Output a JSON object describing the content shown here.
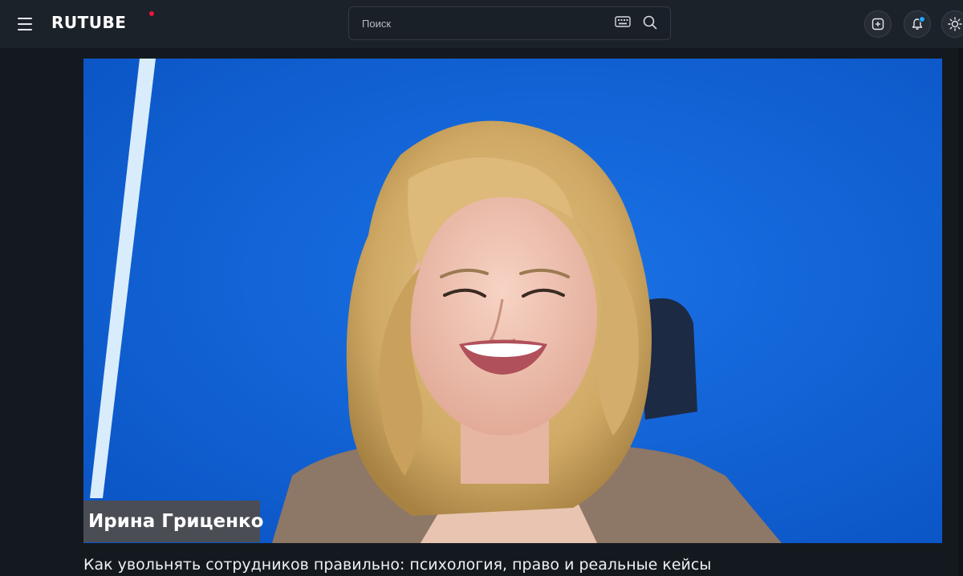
{
  "header": {
    "logo_text": "RUTUBE",
    "search": {
      "placeholder": "Поиск",
      "value": ""
    },
    "icons": {
      "menu": "hamburger-menu-icon",
      "keyboard": "keyboard-icon",
      "search": "search-icon",
      "upload": "add-video-icon",
      "notifications": "bell-icon",
      "theme": "sun-icon"
    },
    "notification_badge_color": "#22a7ff",
    "logo_accent_color": "#ed143b"
  },
  "video": {
    "lower_third_name": "Ирина Гриценко",
    "title": "Как увольнять сотрудников правильно: психология, право и реальные кейсы"
  },
  "colors": {
    "background": "#14191f",
    "header": "#1c2229",
    "video_backdrop": "#0f5fd6"
  }
}
